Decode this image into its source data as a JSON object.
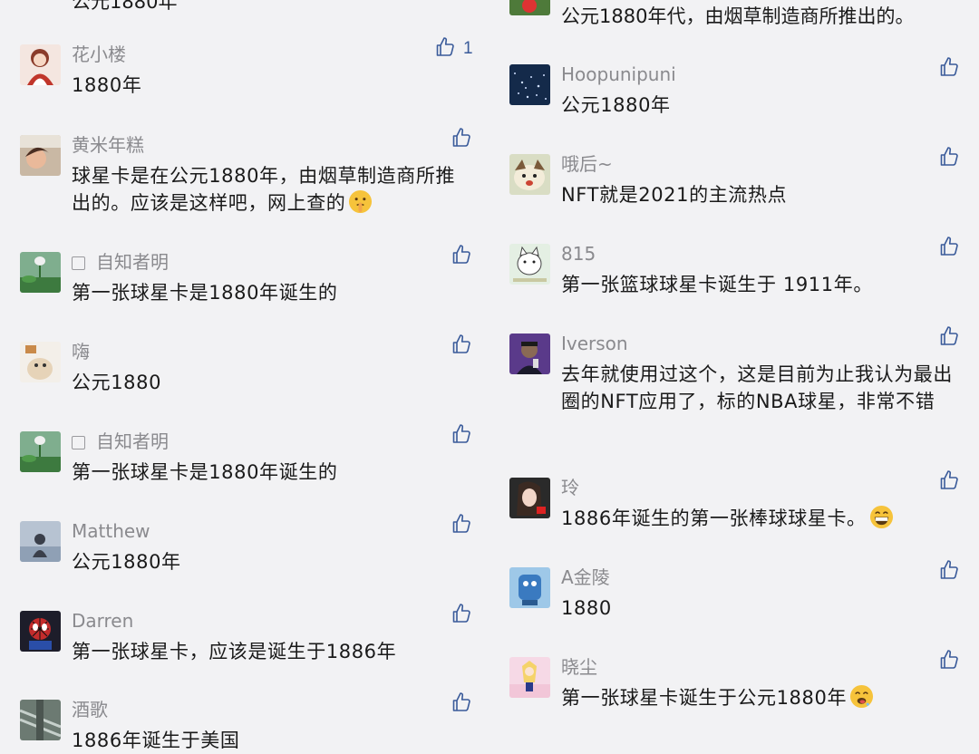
{
  "left": {
    "partial_top_text": "公元1880年",
    "comments": [
      {
        "name": "花小楼",
        "text": "1880年",
        "likes": "1",
        "avatar": "avatar-girl-red"
      },
      {
        "name": "黄米年糕",
        "text": "球星卡是在公元1880年，由烟草制造商所推出的。应该是这样吧，网上查的",
        "likes": "",
        "avatar": "avatar-child",
        "emoji": "shushing-face"
      },
      {
        "name": "自知者明",
        "text": "第一张球星卡是1880年诞生的",
        "likes": "",
        "avatar": "avatar-lotus",
        "checkbox": true
      },
      {
        "name": "嗨",
        "text": "公元1880",
        "likes": "",
        "avatar": "avatar-cartoon"
      },
      {
        "name": "自知者明",
        "text": "第一张球星卡是1880年诞生的",
        "likes": "",
        "avatar": "avatar-lotus",
        "checkbox": true
      },
      {
        "name": "Matthew",
        "text": "公元1880年",
        "likes": "",
        "avatar": "avatar-silhouette"
      },
      {
        "name": "Darren",
        "text": "第一张球星卡，应该是诞生于1886年",
        "likes": "",
        "avatar": "avatar-spiderman"
      },
      {
        "name": "酒歌",
        "text": "1886年诞生于美国",
        "likes": "",
        "avatar": "avatar-escalator"
      }
    ]
  },
  "right": {
    "partial_top_text": "公元1880年代，由烟草制造商所推出的。",
    "comments": [
      {
        "name": "Hoopunipuni",
        "text": "公元1880年",
        "likes": "",
        "avatar": "avatar-stars"
      },
      {
        "name": "哦后~",
        "text": "NFT就是2021的主流热点",
        "likes": "",
        "avatar": "avatar-dog"
      },
      {
        "name": "815",
        "text": "第一张篮球球星卡诞生于 1911年。",
        "likes": "",
        "avatar": "avatar-cat-815"
      },
      {
        "name": "Iverson",
        "text": "去年就使用过这个，这是目前为止我认为最出圈的NFT应用了，标的NBA球星，非常不错",
        "likes": "",
        "avatar": "avatar-man-purple"
      },
      {
        "name": "玲",
        "text": "1886年诞生的第一张棒球球星卡。",
        "likes": "",
        "avatar": "avatar-woman",
        "emoji": "grinning-face"
      },
      {
        "name": "A金陵",
        "text": "1880",
        "likes": "",
        "avatar": "avatar-blue-toy"
      },
      {
        "name": "晓尘",
        "text": "第一张球星卡诞生于公元1880年",
        "likes": "",
        "avatar": "avatar-sailor",
        "emoji": "drooling-face"
      }
    ]
  },
  "colors": {
    "background": "#f2f2f4",
    "name": "#8a8a8e",
    "text": "#1a1a1a",
    "like_icon": "#3a5b9a"
  }
}
